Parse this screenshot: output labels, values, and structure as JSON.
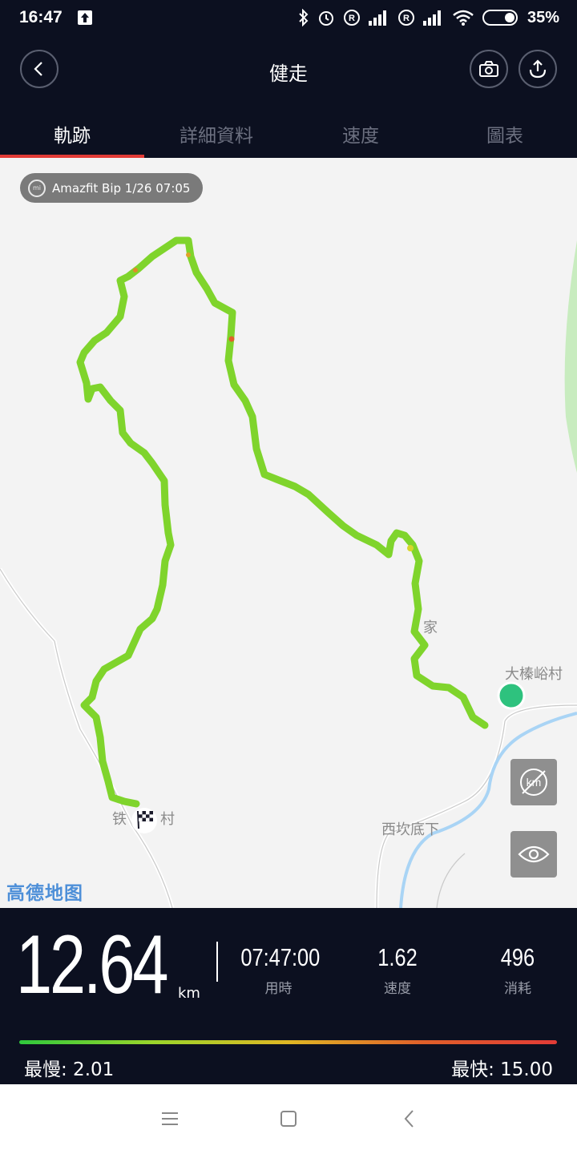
{
  "status_bar": {
    "time": "16:47",
    "battery": "35%",
    "icons": [
      "upload-icon",
      "bluetooth-icon",
      "alarm-icon",
      "roaming-icon",
      "signal-icon",
      "roaming-icon",
      "signal-icon",
      "wifi-icon",
      "battery-icon"
    ]
  },
  "header": {
    "title": "健走",
    "back_icon": "back-icon",
    "camera_icon": "camera-icon",
    "share_icon": "share-icon"
  },
  "tabs": [
    {
      "label": "軌跡",
      "active": true
    },
    {
      "label": "詳細資料",
      "active": false
    },
    {
      "label": "速度",
      "active": false
    },
    {
      "label": "圖表",
      "active": false
    }
  ],
  "map": {
    "device_chip": "Amazfit Bip  1/26 07:05",
    "labels": {
      "village_1": "大榛峪村",
      "village_2": "西坎底下",
      "village_3": "铁",
      "village_3_suffix": "村",
      "village_4": "家"
    },
    "provider": "高德地图",
    "controls": [
      "km-toggle-icon",
      "eye-icon"
    ]
  },
  "stats": {
    "distance": "12.64",
    "distance_unit": "km",
    "duration": {
      "value": "07:47:00",
      "label": "用時"
    },
    "speed": {
      "value": "1.62",
      "label": "速度"
    },
    "calories": {
      "value": "496",
      "label": "消耗"
    },
    "slowest": "最慢: 2.01",
    "fastest": "最快: 15.00"
  },
  "colors": {
    "background": "#0c1020",
    "accent": "#e23b36",
    "route": "#7fd42c",
    "start_marker": "#2ec27e"
  }
}
